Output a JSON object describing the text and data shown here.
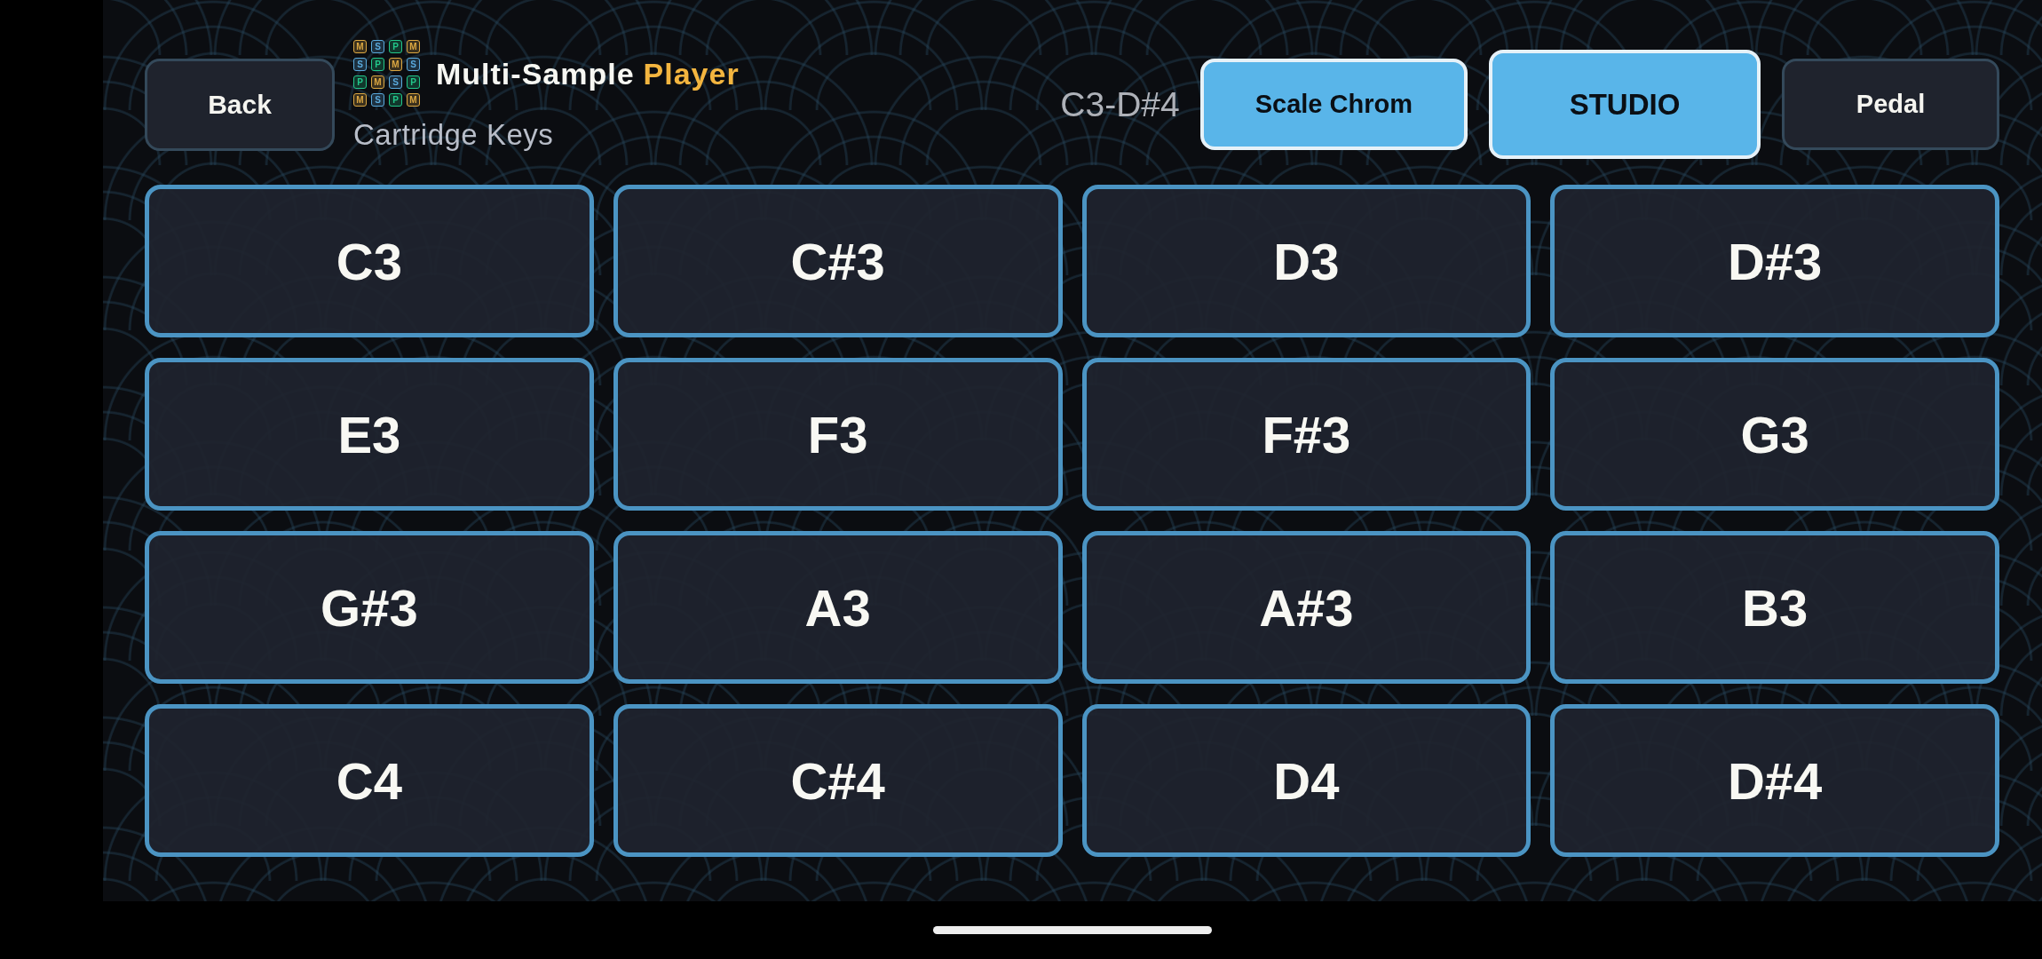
{
  "header": {
    "back_button": "Back",
    "logo": [
      {
        "letter": "M",
        "color": "#dba742"
      },
      {
        "letter": "S",
        "color": "#5aaadd"
      },
      {
        "letter": "P",
        "color": "#22c78a"
      },
      {
        "letter": "M",
        "color": "#dba742"
      },
      {
        "letter": "S",
        "color": "#5aaadd"
      },
      {
        "letter": "P",
        "color": "#22c78a"
      },
      {
        "letter": "M",
        "color": "#dba742"
      },
      {
        "letter": "S",
        "color": "#5aaadd"
      },
      {
        "letter": "P",
        "color": "#22c78a"
      },
      {
        "letter": "M",
        "color": "#dba742"
      },
      {
        "letter": "S",
        "color": "#5aaadd"
      },
      {
        "letter": "P",
        "color": "#22c78a"
      },
      {
        "letter": "M",
        "color": "#dba742"
      },
      {
        "letter": "S",
        "color": "#5aaadd"
      },
      {
        "letter": "P",
        "color": "#22c78a"
      },
      {
        "letter": "M",
        "color": "#dba742"
      }
    ],
    "title": "Multi-Sample",
    "title_accent": "Player",
    "subtitle": "Cartridge Keys",
    "range": "C3-D#4",
    "buttons": [
      {
        "label": "Scale Chrom",
        "kind": "toggle",
        "on": true
      },
      {
        "label": "STUDIO",
        "kind": "mode",
        "on": true
      },
      {
        "label": "Pedal",
        "kind": "toggle",
        "on": false
      }
    ]
  },
  "pads": [
    "C3",
    "C#3",
    "D3",
    "D#3",
    "E3",
    "F3",
    "F#3",
    "G3",
    "G#3",
    "A3",
    "A#3",
    "B3",
    "C4",
    "C#4",
    "D4",
    "D#4"
  ]
}
